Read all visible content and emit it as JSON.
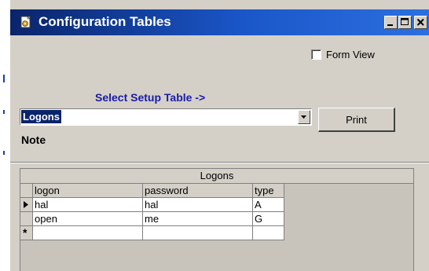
{
  "window": {
    "title": "Configuration Tables",
    "colors": {
      "titlebar": "#0a246a",
      "face": "#d4d0c8",
      "link_blue": "#1a1aa8",
      "selection": "#0a246a"
    }
  },
  "form_view": {
    "label": "Form View",
    "checked": false
  },
  "setup": {
    "label": "Select Setup Table ->",
    "selected": "Logons"
  },
  "print_button": {
    "label": "Print"
  },
  "note": {
    "label": "Note"
  },
  "grid": {
    "caption": "Logons",
    "columns": [
      "logon",
      "password",
      "type"
    ],
    "rows": [
      {
        "logon": "hal",
        "password": "hal",
        "type": "A",
        "current": true
      },
      {
        "logon": "open",
        "password": "me",
        "type": "G",
        "current": false
      }
    ],
    "new_row_marker": "*"
  },
  "icons": [
    "app-icon",
    "minimize-icon",
    "maximize-icon",
    "close-icon",
    "dropdown-arrow-icon",
    "current-row-arrow-icon",
    "new-row-star-icon"
  ]
}
